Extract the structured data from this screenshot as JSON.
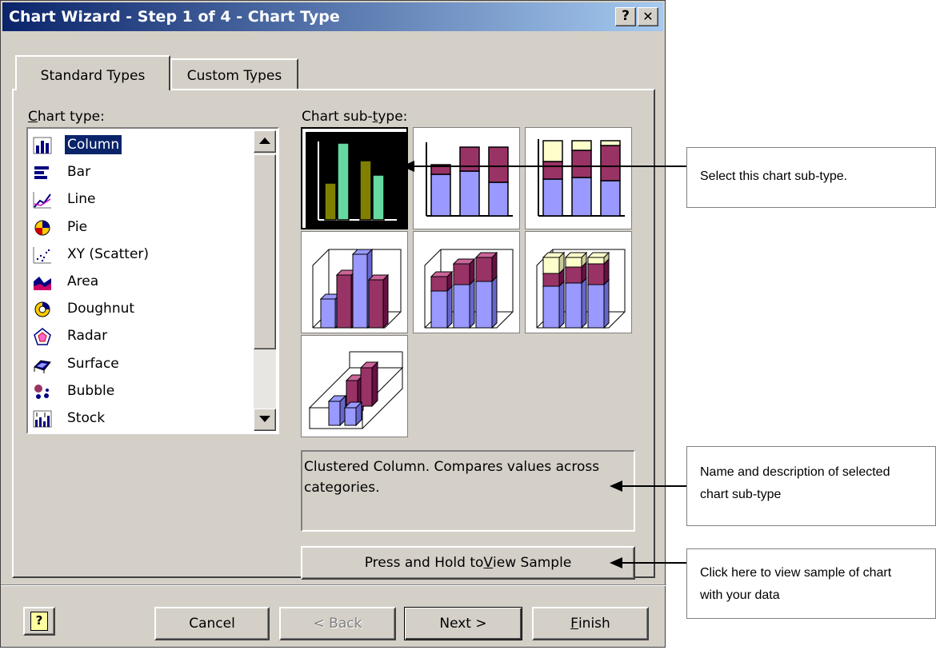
{
  "window": {
    "title": "Chart Wizard - Step 1 of 4 - Chart Type",
    "help_glyph": "?",
    "close_glyph": "✕"
  },
  "tabs": [
    {
      "label": "Standard Types",
      "active": true
    },
    {
      "label": "Custom Types",
      "active": false
    }
  ],
  "chart_type": {
    "label_accel": "C",
    "label_rest": "hart type:",
    "items": [
      {
        "label": "Column",
        "icon": "column-chart-icon",
        "selected": true
      },
      {
        "label": "Bar",
        "icon": "bar-chart-icon"
      },
      {
        "label": "Line",
        "icon": "line-chart-icon"
      },
      {
        "label": "Pie",
        "icon": "pie-chart-icon"
      },
      {
        "label": "XY (Scatter)",
        "icon": "scatter-chart-icon"
      },
      {
        "label": "Area",
        "icon": "area-chart-icon"
      },
      {
        "label": "Doughnut",
        "icon": "doughnut-chart-icon"
      },
      {
        "label": "Radar",
        "icon": "radar-chart-icon"
      },
      {
        "label": "Surface",
        "icon": "surface-chart-icon"
      },
      {
        "label": "Bubble",
        "icon": "bubble-chart-icon"
      },
      {
        "label": "Stock",
        "icon": "stock-chart-icon"
      }
    ]
  },
  "chart_subtype": {
    "label_pre": "Chart sub-",
    "label_accel": "t",
    "label_post": "ype:",
    "cells": [
      {
        "name": "clustered-column",
        "selected": true
      },
      {
        "name": "stacked-column"
      },
      {
        "name": "100-stacked-column"
      },
      {
        "name": "clustered-column-3d-effect"
      },
      {
        "name": "stacked-column-3d-effect"
      },
      {
        "name": "100-stacked-column-3d-effect"
      },
      {
        "name": "3d-column"
      }
    ],
    "colors": {
      "olive": "#808000",
      "mint": "#66d9a0",
      "periwinkle": "#9999ff",
      "plum": "#993366",
      "cream": "#ffffcc"
    }
  },
  "description": "Clustered Column. Compares values across categories.",
  "sample_button": {
    "pre": "Press and Hold to ",
    "accel": "V",
    "post": "iew Sample"
  },
  "footer": {
    "help_glyph": "?",
    "cancel": "Cancel",
    "back": "< Back",
    "next": "Next >",
    "finish_accel": "F",
    "finish_rest": "inish"
  },
  "callouts": [
    {
      "text": "Select this chart sub-type."
    },
    {
      "text": "Name and description of selected chart sub-type"
    },
    {
      "text": "Click here to view sample of chart with your data"
    }
  ]
}
